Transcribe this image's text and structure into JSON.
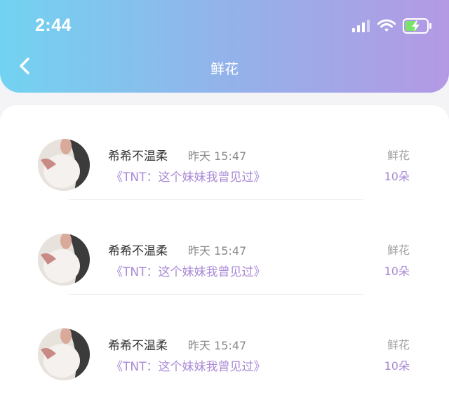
{
  "status_bar": {
    "time": "2:44",
    "icons": [
      "signal-icon",
      "wifi-icon",
      "battery-charging-icon"
    ]
  },
  "nav": {
    "back_icon": "chevron-left-icon",
    "title": "鲜花"
  },
  "colors": {
    "header_gradient": [
      "#72d3f1",
      "#b399e4"
    ],
    "accent": "#a98ad6"
  },
  "records": [
    {
      "name": "希希不温柔",
      "time": "昨天 15:47",
      "message": "《TNT：这个妹妹我曾见过》",
      "gift_label": "鲜花",
      "count": "10朵"
    },
    {
      "name": "希希不温柔",
      "time": "昨天 15:47",
      "message": "《TNT：这个妹妹我曾见过》",
      "gift_label": "鲜花",
      "count": "10朵"
    },
    {
      "name": "希希不温柔",
      "time": "昨天 15:47",
      "message": "《TNT：这个妹妹我曾见过》",
      "gift_label": "鲜花",
      "count": "10朵"
    }
  ]
}
